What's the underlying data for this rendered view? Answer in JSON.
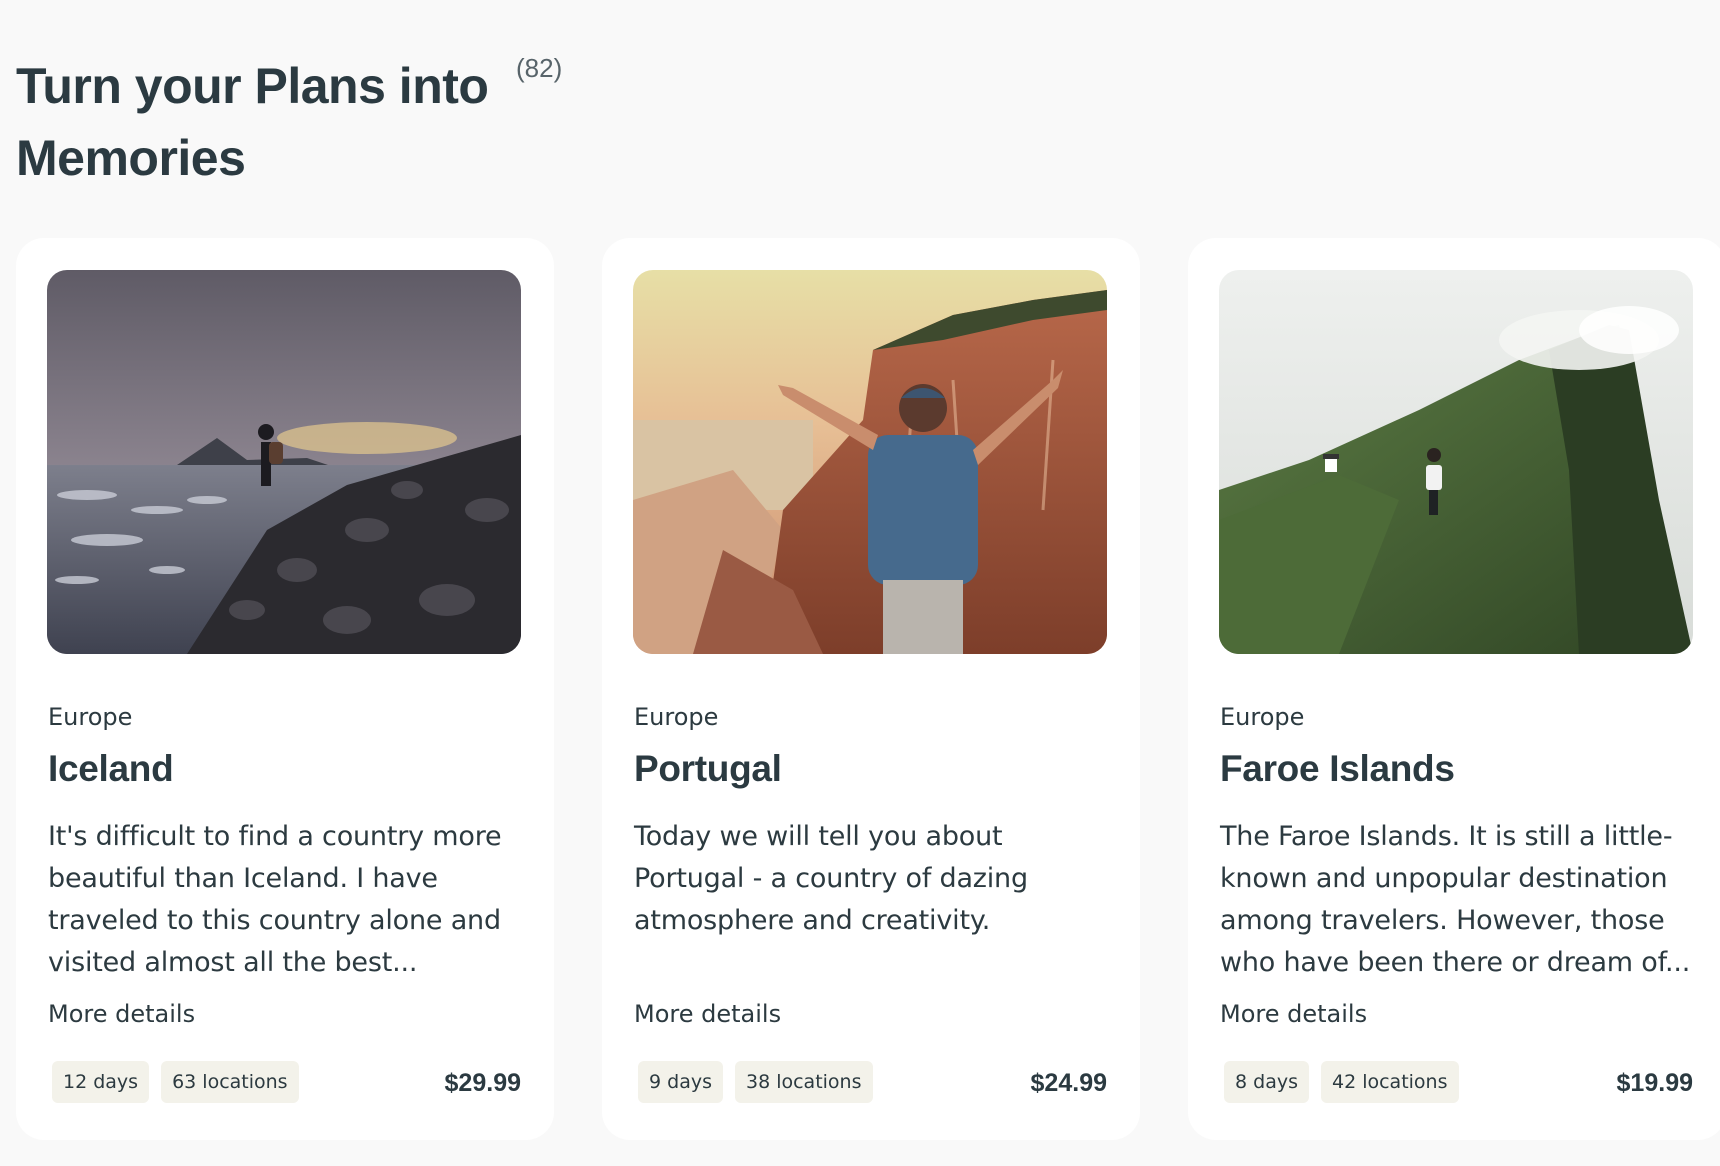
{
  "section": {
    "title": "Turn your Plans into Memories",
    "count": "(82)"
  },
  "cards": [
    {
      "region": "Europe",
      "name": "Iceland",
      "description": "It's difficult to find a country more beautiful than Iceland. I have traveled to this country alone and visited almost all the best...",
      "more_label": "More details",
      "days": "12 days",
      "locations": "63 locations",
      "price": "$29.99"
    },
    {
      "region": "Europe",
      "name": "Portugal",
      "description": "Today we will tell you about Portugal - a country of dazing atmosphere and creativity.",
      "more_label": "More details",
      "days": "9 days",
      "locations": "38 locations",
      "price": "$24.99"
    },
    {
      "region": "Europe",
      "name": "Faroe Islands",
      "description": "The Faroe Islands. It is still a little-known and unpopular destination among travelers. However, those who have been there or dream of...",
      "more_label": "More details",
      "days": "8 days",
      "locations": "42 locations",
      "price": "$19.99"
    }
  ]
}
